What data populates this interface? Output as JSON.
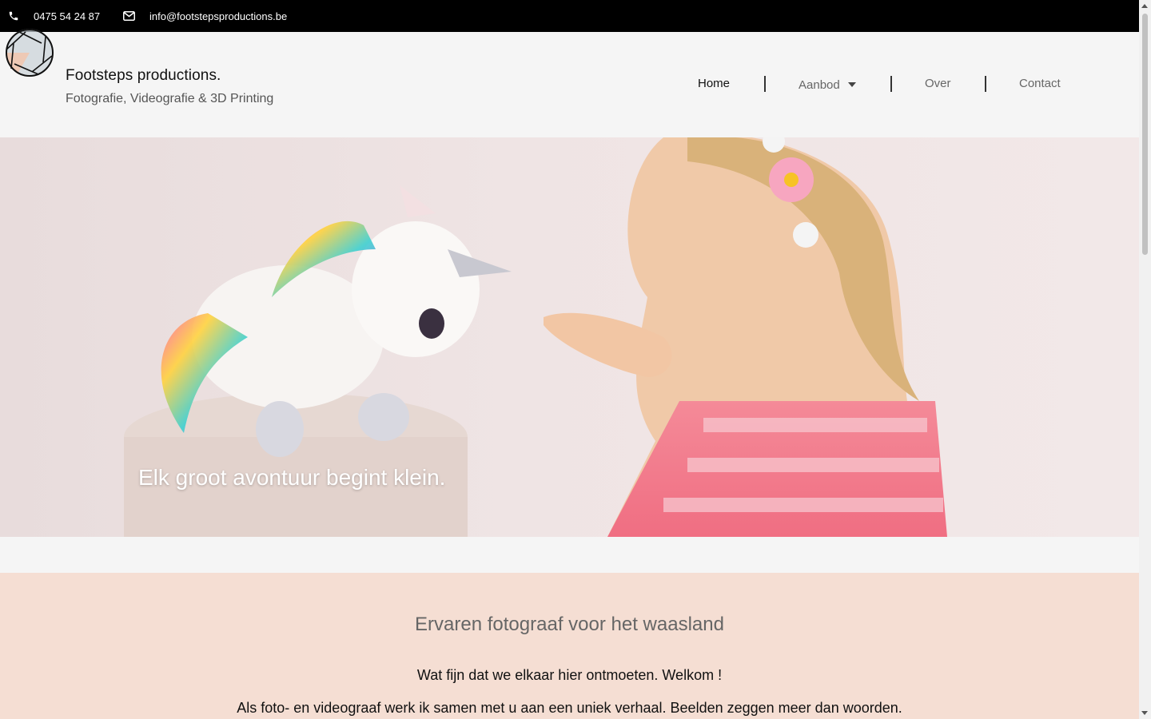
{
  "topbar": {
    "phone": "0475 54 24 87",
    "email": "info@footstepsproductions.be"
  },
  "brand": {
    "name": "Footsteps productions.",
    "tagline": "Fotografie, Videografie & 3D Printing"
  },
  "nav": {
    "home": "Home",
    "aanbod": "Aanbod",
    "over": "Over",
    "contact": "Contact"
  },
  "hero": {
    "caption": "Elk groot avontuur begint klein."
  },
  "section": {
    "heading": "Ervaren fotograaf voor het waasland",
    "welcome": "Wat fijn dat we elkaar hier ontmoeten. Welkom !",
    "intro": "Als foto- en videograaf werk ik samen met u aan een uniek verhaal. Beelden zeggen meer dan woorden."
  },
  "colors": {
    "topbar_bg": "#000000",
    "header_bg": "#f5f5f5",
    "section_bg": "#f5ded3"
  }
}
